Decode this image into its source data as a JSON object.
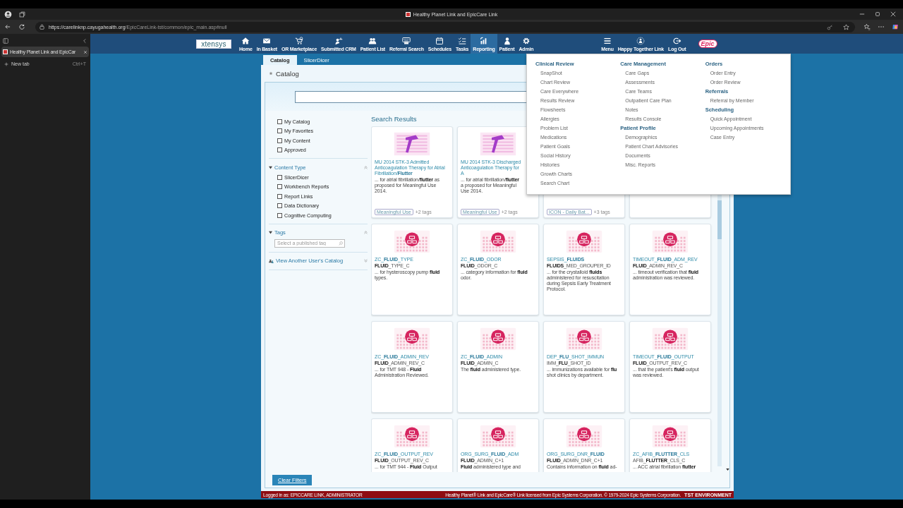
{
  "browser": {
    "window_title": "Healthy Planet Link and EpicCare Link",
    "url_host": "https://carelinknp.cayugahealth.org",
    "url_path": "/EpicCareLink-tst/common/epic_main.asp#null",
    "tabs": [
      {
        "label": "Healthy Planet Link and EpicCar",
        "selected": true
      }
    ],
    "new_tab": {
      "label": "New tab",
      "shortcut": "Ctrl+T"
    }
  },
  "app": {
    "logo": "xtensys",
    "brand": "Epic",
    "nav": [
      {
        "label": "Home",
        "selected": false
      },
      {
        "label": "In Basket",
        "selected": false
      },
      {
        "label": "OR Marketplace",
        "selected": false
      },
      {
        "label": "Submitted CRM",
        "selected": false
      },
      {
        "label": "Patient List",
        "selected": false
      },
      {
        "label": "Referral Search",
        "selected": false
      },
      {
        "label": "Schedules",
        "selected": false
      },
      {
        "label": "Tasks",
        "selected": false
      },
      {
        "label": "Reporting",
        "selected": true
      },
      {
        "label": "Patient",
        "selected": false
      },
      {
        "label": "Admin",
        "selected": false
      }
    ],
    "nav_right": [
      {
        "label": "Menu"
      },
      {
        "label": "Happy Together Link"
      },
      {
        "label": "Log Out"
      }
    ]
  },
  "tabs": [
    {
      "label": "Catalog",
      "selected": true
    },
    {
      "label": "SlicerDicer",
      "selected": false
    }
  ],
  "page_title": "Catalog",
  "filters": {
    "own": [
      {
        "label": "My Catalog",
        "checked": false
      },
      {
        "label": "My Favorites",
        "checked": false
      },
      {
        "label": "My Content",
        "checked": false
      },
      {
        "label": "Approved",
        "checked": false
      }
    ],
    "content_type": {
      "title": "Content Type",
      "expanded": true,
      "items": [
        {
          "label": "SlicerDicer",
          "checked": false
        },
        {
          "label": "Workbench Reports",
          "checked": false
        },
        {
          "label": "Report Links",
          "checked": false
        },
        {
          "label": "Data Dictionary",
          "checked": false
        },
        {
          "label": "Cognitive Computing",
          "checked": false
        }
      ]
    },
    "tags": {
      "title": "Tags",
      "expanded": true,
      "placeholder": "Select a published tag"
    },
    "other_user": {
      "title": "View Another User's Catalog",
      "expanded": false
    }
  },
  "results_title": "Search Results",
  "cards": [
    {
      "kind": "hammer",
      "title": "MU 2014 STK-3 Admitted Anticoagulation Therapy for Atrial Fibrillation/**Flutter**",
      "description": "... for atrial fibrillation/**flutter** as proposed for Meaningful Use 2014.",
      "tags": [
        "Meaningful Use"
      ],
      "more_tags": "+2 tags"
    },
    {
      "kind": "hammer",
      "title": "MU 2014 STK-3 Discharged Anticoagulation Therapy for A",
      "description": "... for atrial fibrillation/**flutter** a proposed for Meaningful Use 2014.",
      "tags": [
        "Meaningful Use"
      ],
      "more_tags": "+2 tags"
    },
    {
      "kind": "covered",
      "tags": [
        "ICON - Daily Bat..."
      ],
      "more_tags": "+3 tags"
    },
    {
      "kind": "covered"
    },
    {
      "kind": "table",
      "title": "ZC_**FLUID**_TYPE",
      "item": "**FLUID**_TYPE_C",
      "description": "... for hysteroscopy pump **fluid** types."
    },
    {
      "kind": "table",
      "title": "ZC_**FLUID**_ODOR",
      "item": "**FLUID**_ODOR_C",
      "description": "... category information for **fluid** odor."
    },
    {
      "kind": "table",
      "title": "SEPSIS_**FLUIDS**",
      "item": "**FLUIDS**_MED_GROUPER_ID",
      "description": "... for the crystalloid **fluids** administered for resuscitation during Sepsis Early Treatment Protocol."
    },
    {
      "kind": "table",
      "title": "TIMEOUT_**FLUID**_ADM_REV",
      "item": "**FLUID**_ADMIN_REV_C",
      "description": "... timeout verification that **fluid** administration was reviewed."
    },
    {
      "kind": "table",
      "title": "ZC_**FLUID**_ADMIN_REV",
      "item": "**FLUID**_ADMIN_REV_C",
      "description": "... for TMT 948 - **Fluid** Administration Reviewed."
    },
    {
      "kind": "table",
      "title": "ZC_**FLUID**_ADMIN",
      "item": "**FLUID**_ADMIN_C",
      "description": "The **fluid** administered type."
    },
    {
      "kind": "table",
      "title": "DEP_**FLU**_SHOT_IMMUN",
      "item": "IMM_**FLU**_SHOT_ID",
      "description": "... immunizations available for **flu** shot clinics by department."
    },
    {
      "kind": "table",
      "title": "TIMEOUT_**FLUID**_OUTPUT",
      "item": "**FLUID**_OUTPUT_REV_C",
      "description": "... that the patient's **fluid** output was reviewed."
    },
    {
      "kind": "table",
      "title": "ZC_**FLUID**_OUTPUT_REV",
      "item": "**FLUID**_OUTPUT_REV_C",
      "description": "... for TMT 944 - **Fluid** Output"
    },
    {
      "kind": "table",
      "title": "ORG_SURG_**FLUID**_ADM",
      "item": "**FLUID**_ADMIN_C+1",
      "description": "**Fluid** administered type and"
    },
    {
      "kind": "table",
      "title": "ORG_SURG_DNR_**FLUID**",
      "item": "**FLUID**_ADMIN_DNR_C+1",
      "description": "Contains information on **fluid** ad-"
    },
    {
      "kind": "table",
      "title": "ZC_AFIB_**FLUTTER**_CLS",
      "item": "AFIB_**FLUTTER**_CLS_C",
      "description": "... ACC atrial fibrillation **flutter**"
    }
  ],
  "clear_button": "Clear Filters",
  "menu": {
    "columns": [
      [
        {
          "heading": "Clinical Review",
          "items": [
            "SnapShot",
            "Chart Review",
            "Care Everywhere",
            "Results Review",
            "Flowsheets",
            "Allergies",
            "Problem List",
            "Medications",
            "Patient Goals",
            "Social History",
            "Histories",
            "Growth Charts",
            "Search Chart"
          ]
        }
      ],
      [
        {
          "heading": "Care Management",
          "items": [
            "Care Gaps",
            "Assessments",
            "Care Teams",
            "Outpatient Care Plan",
            "Notes",
            "Results Console"
          ]
        },
        {
          "heading": "Patient Profile",
          "items": [
            "Demographics",
            "Patient Chart Advisories",
            "Documents",
            "Misc. Reports"
          ]
        }
      ],
      [
        {
          "heading": "Orders",
          "items": [
            "Order Entry",
            "Order Review"
          ]
        },
        {
          "heading": "Referrals",
          "items": [
            "Referral by Member"
          ]
        },
        {
          "heading": "Scheduling",
          "items": [
            "Quick Appointment",
            "Upcoming Appointments",
            "Case Entry"
          ]
        }
      ]
    ]
  },
  "footer": {
    "login": "Logged in as: EPICCARE LINK, ADMINISTRATOR",
    "license": "Healthy Planet® Link and EpicCare® Link licensed from Epic Systems Corporation. © 1979-2024 Epic Systems Corporation.",
    "environment": "TST ENVIRONMENT"
  }
}
